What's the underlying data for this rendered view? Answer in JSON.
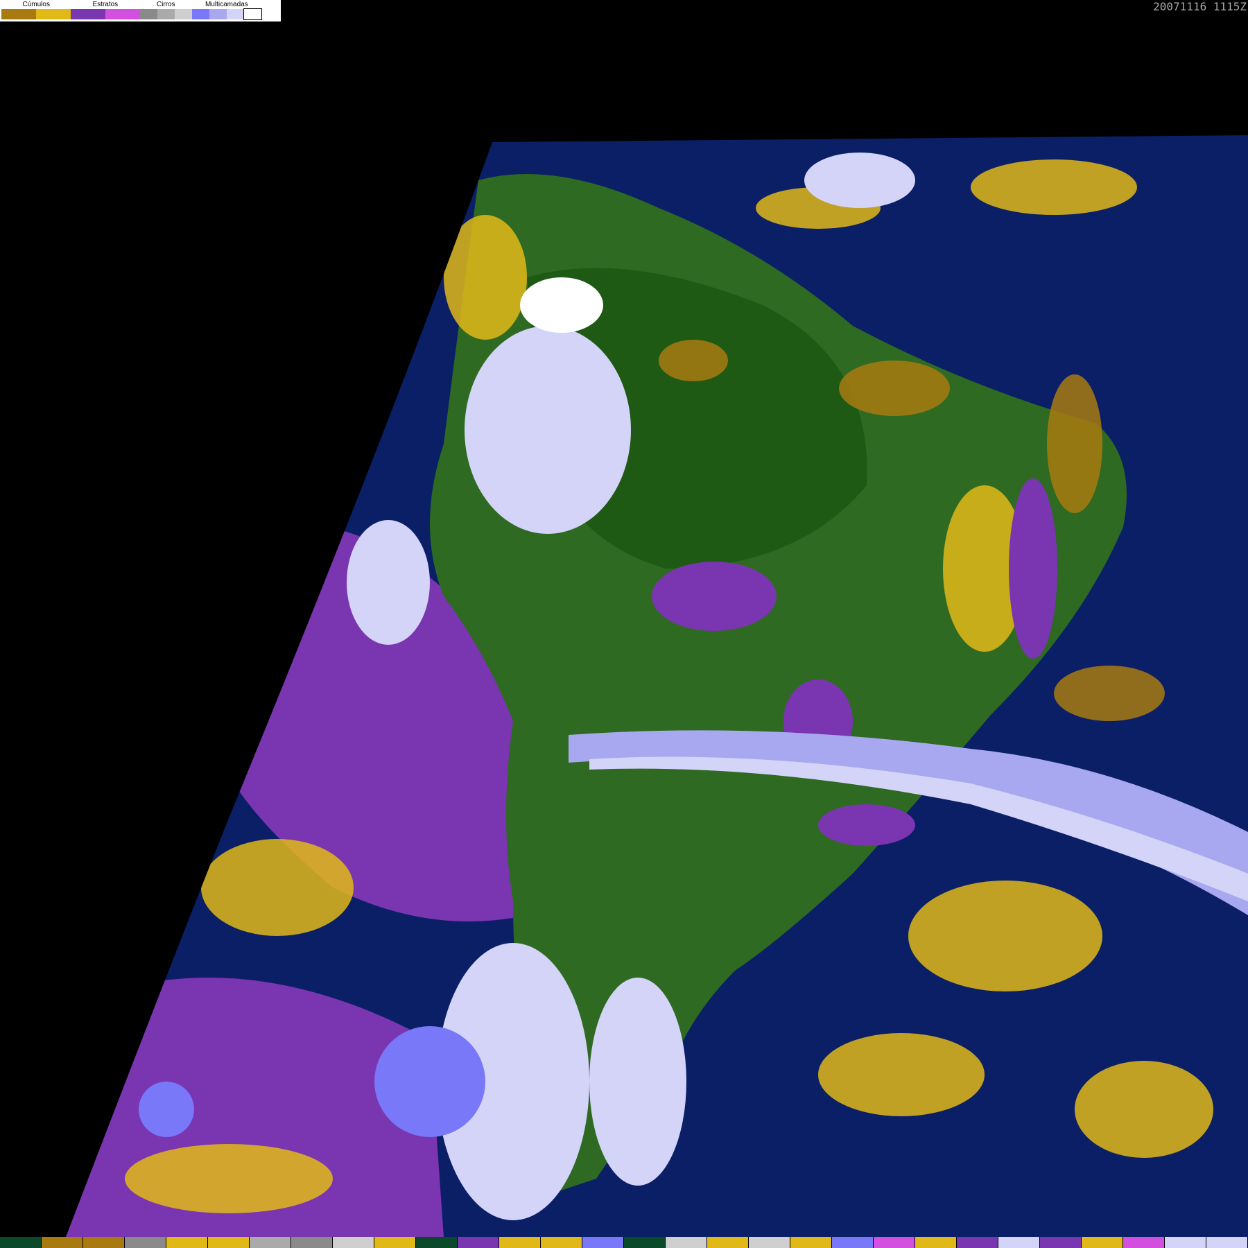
{
  "legend": {
    "groups": [
      {
        "label": "Cúmulos",
        "colors": [
          "#a87a10",
          "#e0b818"
        ]
      },
      {
        "label": "Estratos",
        "colors": [
          "#7a35b0",
          "#d24fe0"
        ]
      },
      {
        "label": "Cirros",
        "colors": [
          "#8a8a8a",
          "#aaaaaa",
          "#cfcfcf"
        ]
      },
      {
        "label": "Multicamadas",
        "colors": [
          "#7878f8",
          "#a8a8f0",
          "#d4d4f8",
          "#ffffff"
        ]
      }
    ]
  },
  "timestamp": "20071116 1115Z",
  "colors": {
    "background": "#000000",
    "ocean": "#0a1f66",
    "land": "#2e6a22",
    "forest": "#1f5a14",
    "stratus": "#7a35b0",
    "cumulus_dark": "#a87a10",
    "cumulus_light": "#e0b818",
    "multilayer_light": "#d4d4f8"
  },
  "bottom_bar": [
    "#0a4a2a",
    "#a87a10",
    "#a87a10",
    "#8a8a8a",
    "#e0b818",
    "#e0b818",
    "#aaaaaa",
    "#8a8a8a",
    "#cfcfcf",
    "#e0b818",
    "#0a4a2a",
    "#7a35b0",
    "#e0b818",
    "#e0b818",
    "#7878f8",
    "#0a4a2a",
    "#cfcfcf",
    "#e0b818",
    "#cfcfcf",
    "#e0b818",
    "#7878f8",
    "#d24fe0",
    "#e0b818",
    "#7a35b0",
    "#d4d4f8",
    "#7a35b0",
    "#e0b818",
    "#d24fe0",
    "#d4d4f8",
    "#d4d4f8"
  ]
}
